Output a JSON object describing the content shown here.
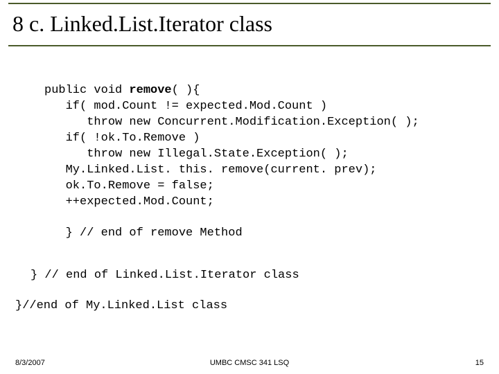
{
  "title": "8 c. Linked.List.Iterator class",
  "code": {
    "l1a": "public void ",
    "l1b": "remove",
    "l1c": "( ){",
    "l2": "   if( mod.Count != expected.Mod.Count )",
    "l3": "      throw new Concurrent.Modification.Exception( );",
    "l4": "   if( !ok.To.Remove )",
    "l5": "      throw new Illegal.State.Exception( );",
    "l6": "   My.Linked.List. this. remove(current. prev);",
    "l7": "   ok.To.Remove = false;",
    "l8": "   ++expected.Mod.Count;",
    "l9": "",
    "l10": "   } // end of remove Method"
  },
  "closer1": "} // end of Linked.List.Iterator class",
  "closer2": "}//end of My.Linked.List class",
  "footer": {
    "date": "8/3/2007",
    "center": "UMBC CMSC 341 LSQ",
    "page": "15"
  }
}
